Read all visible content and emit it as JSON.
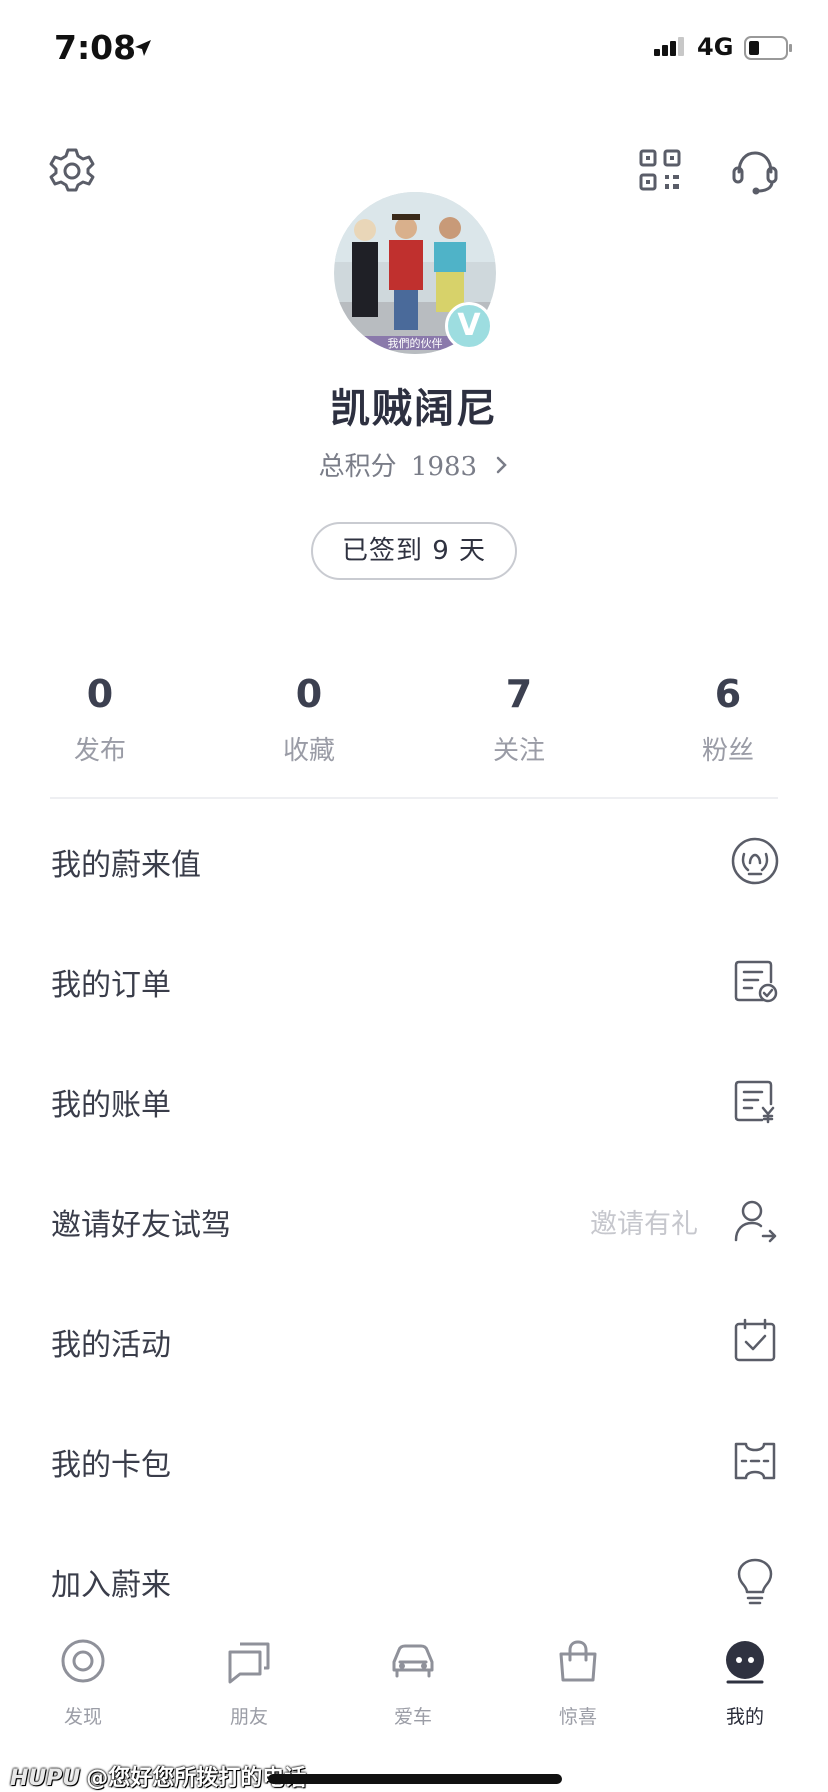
{
  "status_bar": {
    "time": "7:08",
    "network": "4G"
  },
  "profile": {
    "username": "凯贼阔尼",
    "points_label": "总积分",
    "points_value": "1983",
    "checkin_label": "已签到 9 天",
    "avatar_caption": "我們的伙伴",
    "verified_mark": "V"
  },
  "stats": [
    {
      "value": "0",
      "label": "发布"
    },
    {
      "value": "0",
      "label": "收藏"
    },
    {
      "value": "7",
      "label": "关注"
    },
    {
      "value": "6",
      "label": "粉丝"
    }
  ],
  "menu": [
    {
      "label": "我的蔚来值",
      "hint": "",
      "icon": "laurel-badge-icon"
    },
    {
      "label": "我的订单",
      "hint": "",
      "icon": "order-check-icon"
    },
    {
      "label": "我的账单",
      "hint": "",
      "icon": "bill-yen-icon"
    },
    {
      "label": "邀请好友试驾",
      "hint": "邀请有礼",
      "icon": "invite-user-icon"
    },
    {
      "label": "我的活动",
      "hint": "",
      "icon": "calendar-check-icon"
    },
    {
      "label": "我的卡包",
      "hint": "",
      "icon": "ticket-icon"
    },
    {
      "label": "加入蔚来",
      "hint": "",
      "icon": "lightbulb-icon"
    }
  ],
  "tabs": [
    {
      "label": "发现",
      "icon": "discover-icon",
      "active": false
    },
    {
      "label": "朋友",
      "icon": "friends-chat-icon",
      "active": false
    },
    {
      "label": "爱车",
      "icon": "car-icon",
      "active": false
    },
    {
      "label": "惊喜",
      "icon": "shopping-bag-icon",
      "active": false
    },
    {
      "label": "我的",
      "icon": "profile-face-icon",
      "active": true
    }
  ],
  "watermark": {
    "brand": "HUPU",
    "text": "@您好您所拨打的电话"
  },
  "colors": {
    "text_dark": "#2d3040",
    "text_muted": "#9a9ca6",
    "badge": "#9ddde0",
    "icon": "#5a5d68"
  }
}
